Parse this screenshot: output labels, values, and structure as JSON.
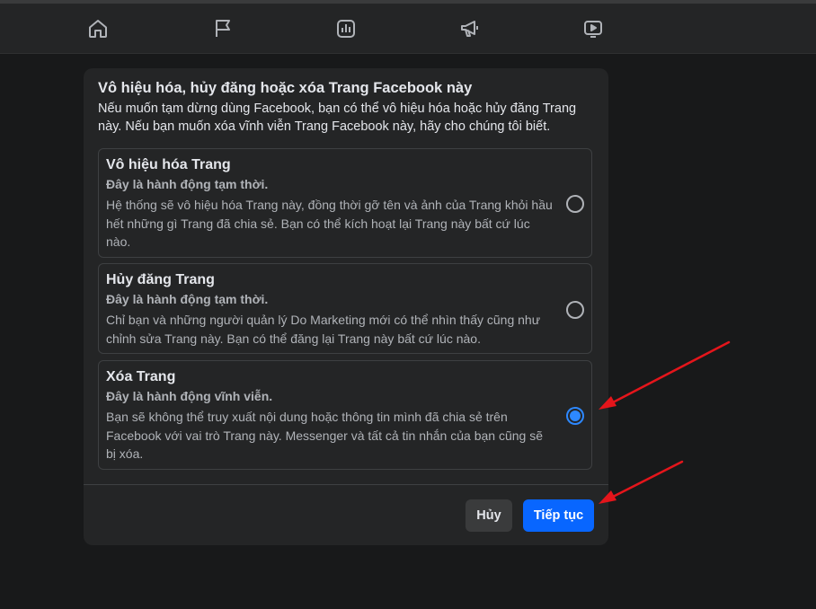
{
  "nav": {
    "icons": [
      "home-icon",
      "flag-icon",
      "insights-icon",
      "megaphone-icon",
      "video-icon"
    ]
  },
  "dialog": {
    "title": "Vô hiệu hóa, hủy đăng hoặc xóa Trang Facebook này",
    "description": "Nếu muốn tạm dừng dùng Facebook, bạn có thể vô hiệu hóa hoặc hủy đăng Trang này. Nếu bạn muốn xóa vĩnh viễn Trang Facebook này, hãy cho chúng tôi biết.",
    "options": [
      {
        "title": "Vô hiệu hóa Trang",
        "subtitle": "Đây là hành động tạm thời.",
        "body": "Hệ thống sẽ vô hiệu hóa Trang này, đồng thời gỡ tên và ảnh của Trang khỏi hầu hết những gì Trang đã chia sẻ. Bạn có thể kích hoạt lại Trang này bất cứ lúc nào.",
        "selected": false
      },
      {
        "title": "Hủy đăng Trang",
        "subtitle": "Đây là hành động tạm thời.",
        "body": "Chỉ bạn và những người quản lý Do Marketing mới có thể nhìn thấy cũng như chỉnh sửa Trang này. Bạn có thể đăng lại Trang này bất cứ lúc nào.",
        "selected": false
      },
      {
        "title": "Xóa Trang",
        "subtitle": "Đây là hành động vĩnh viễn.",
        "body": "Bạn sẽ không thể truy xuất nội dung hoặc thông tin mình đã chia sẻ trên Facebook với vai trò Trang này. Messenger và tất cả tin nhắn của bạn cũng sẽ bị xóa.",
        "selected": true
      }
    ],
    "cancel_label": "Hủy",
    "next_label": "Tiếp tục"
  },
  "colors": {
    "background": "#18191a",
    "surface": "#242526",
    "primary_button": "#0866ff",
    "radio_selected": "#2d88ff",
    "annotation_arrow": "#e4151b"
  }
}
